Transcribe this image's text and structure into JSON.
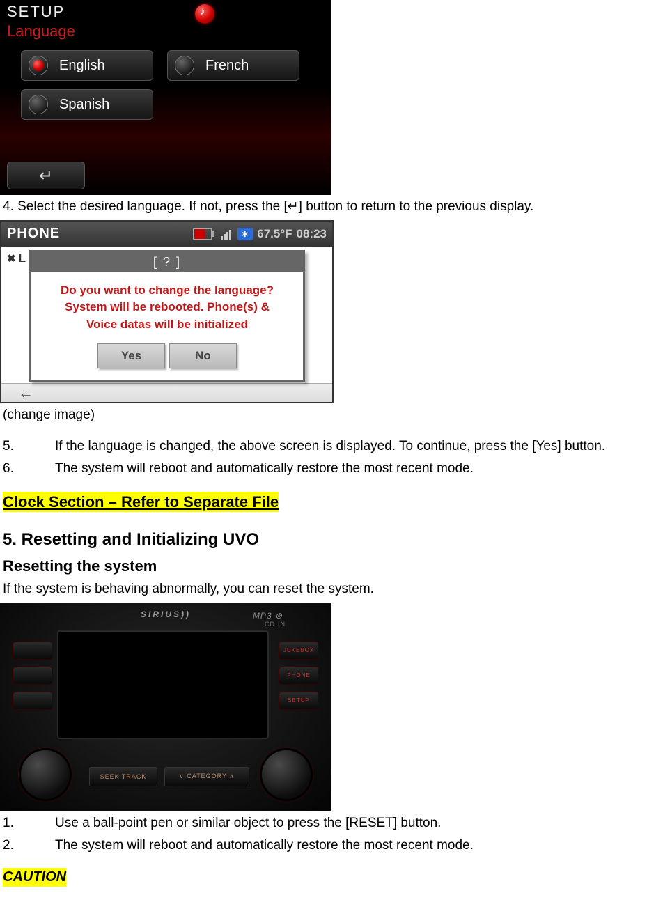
{
  "setup": {
    "title": "SETUP",
    "subtitle": "Language",
    "options": {
      "english": "English",
      "french": "French",
      "spanish": "Spanish"
    },
    "back_glyph": "↵"
  },
  "step4": "4. Select the desired language. If not, press the [↵] button to return to the previous display.",
  "phone": {
    "title": "PHONE",
    "temp": "67.5°F",
    "clock": "08:23",
    "bt_glyph": "∗",
    "behind_partial": "L",
    "popup_title": "[ ? ]",
    "msg_l1": "Do you want to change the language?",
    "msg_l2": "System will be rebooted. Phone(s) &",
    "msg_l3": "Voice datas will be initialized",
    "yes": "Yes",
    "no": "No",
    "footer_arrow": "←"
  },
  "change_image": "(change image)",
  "step5": {
    "n": "5.",
    "t": "If the language is changed, the above screen is displayed. To continue, press the [Yes] button."
  },
  "step6": {
    "n": "6.",
    "t": "The system will reboot and automatically restore the most recent mode."
  },
  "clock_heading": "Clock Section – Refer to Separate File",
  "reset_heading": "5. Resetting and Initializing UVO",
  "reset_sub": "Resetting the system",
  "reset_intro": "If the system is behaving abnormally, you can reset the system.",
  "unit": {
    "brand": "SIRIUS))",
    "mp3": "MP3  ⊚",
    "cdin": "CD·IN",
    "left_btns": [
      "",
      "",
      ""
    ],
    "right_btns": [
      "JUKEBOX",
      "PHONE",
      "SETUP"
    ],
    "seek": "SEEK  TRACK",
    "category": "∨ CATEGORY ∧"
  },
  "r1": {
    "n": "1.",
    "t": "Use a ball-point pen or similar object to press the [RESET] button."
  },
  "r2": {
    "n": "2.",
    "t": "The system will reboot and automatically restore the most recent mode."
  },
  "caution": "CAUTION"
}
